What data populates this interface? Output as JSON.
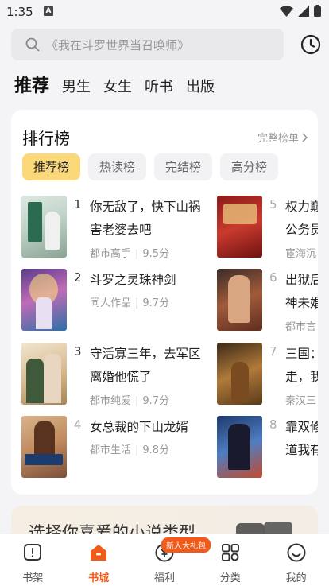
{
  "status": {
    "time": "1:35",
    "notif_letter": "A"
  },
  "search": {
    "placeholder": "《我在斗罗世界当召唤师》"
  },
  "categories": [
    "推荐",
    "男生",
    "女生",
    "听书",
    "出版"
  ],
  "ranking": {
    "title": "排行榜",
    "more": "完整榜单",
    "tabs": [
      "推荐榜",
      "热读榜",
      "完结榜",
      "高分榜"
    ],
    "books": [
      {
        "rank": "1",
        "title": "你无敌了，快下山祸害老婆去吧",
        "category": "都市高手",
        "score": "9.5分"
      },
      {
        "rank": "2",
        "title": "斗罗之灵珠神剑",
        "category": "同人作品",
        "score": "9.7分"
      },
      {
        "rank": "3",
        "title": "守活寡三年，去军区离婚他慌了",
        "category": "都市纯爱",
        "score": "9.7分"
      },
      {
        "rank": "4",
        "title": "女总裁的下山龙婿",
        "category": "都市生活",
        "score": "9.8分"
      },
      {
        "rank": "5",
        "title": "权力巅",
        "title2": "公务员",
        "category": "宦海沉"
      },
      {
        "rank": "6",
        "title": "出狱后",
        "title2": "神未婚",
        "category": "都市言"
      },
      {
        "rank": "7",
        "title": "三国：",
        "title2": "走，我",
        "category": "秦汉三"
      },
      {
        "rank": "8",
        "title": "靠双修",
        "title2": "道我有"
      }
    ]
  },
  "genre_banner": {
    "text": "选择你喜爱的小说类型"
  },
  "nav": {
    "items": [
      "书架",
      "书城",
      "福利",
      "分类",
      "我的"
    ],
    "badge": "新人大礼包",
    "active": "书城"
  },
  "colors": {
    "accent": "#f25a1b",
    "tab_active": "#fbd97a"
  }
}
